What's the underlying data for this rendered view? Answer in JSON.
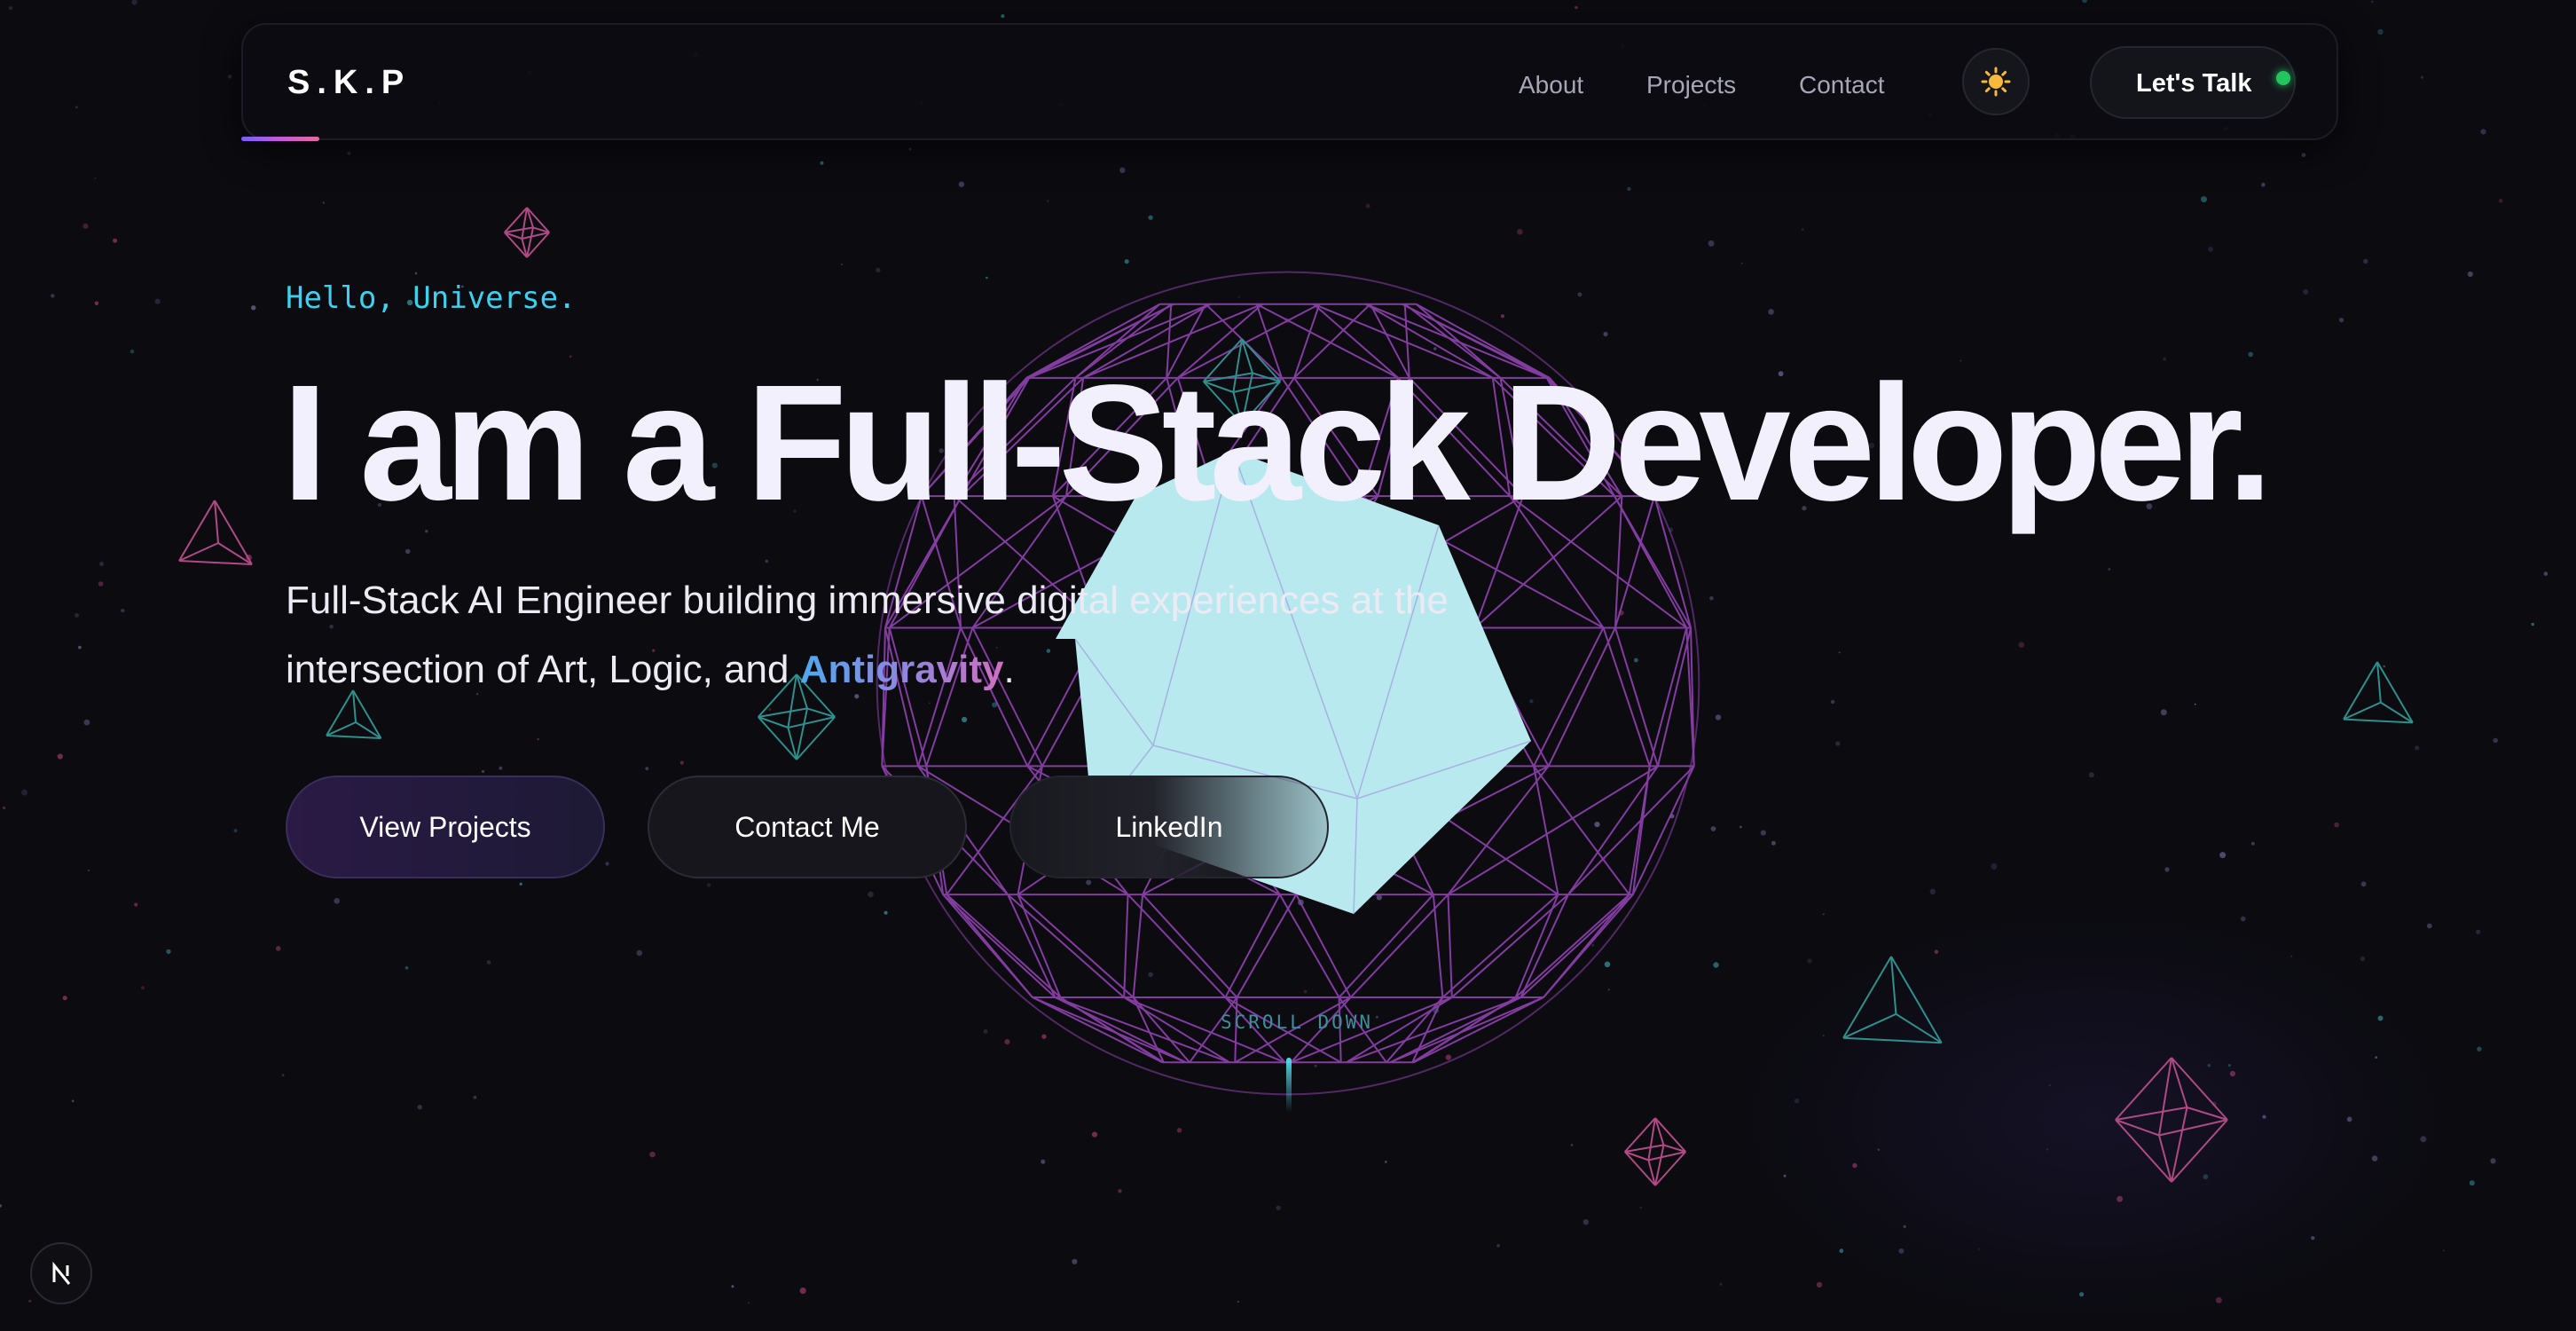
{
  "nav": {
    "logo": "S.K.P",
    "links": [
      "About",
      "Projects",
      "Contact"
    ],
    "theme_icon": "sun-icon",
    "cta_label": "Let's Talk"
  },
  "hero": {
    "greeting": "Hello, Universe.",
    "title": "I am a Full-Stack Developer.",
    "subtitle_text": "Full-Stack AI Engineer building immersive digital experiences at the intersection of Art, Logic, and ",
    "subtitle_accent": "Antigravity",
    "subtitle_end": ".",
    "buttons": [
      "View Projects",
      "Contact Me",
      "LinkedIn"
    ]
  },
  "scroll_hint": "SCROLL DOWN",
  "badge_icon": "nextjs-icon",
  "colors": {
    "background": "#0b0b10",
    "accent_cyan": "#3dd1ee",
    "wireframe_purple": "#8a3fa8",
    "wireframe_teal": "#2f8f8c",
    "wireframe_pink": "#b04a85",
    "polyhedron_fill": "#b8e9ee",
    "status_green": "#22c55e"
  }
}
